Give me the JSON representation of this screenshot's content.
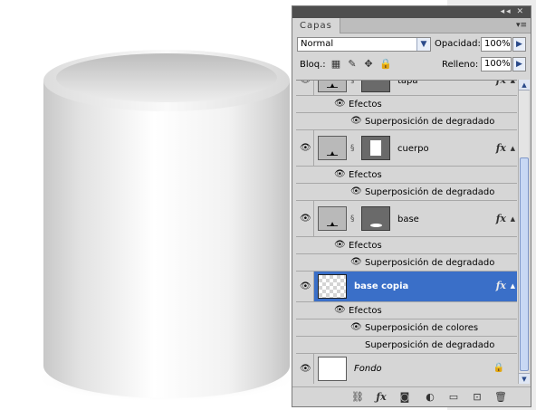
{
  "panel": {
    "tab_label": "Capas",
    "menu_icon": "panel-menu-icon",
    "collapse_icons": "◂◂ ✕",
    "blend_mode": "Normal",
    "opacity_label": "Opacidad:",
    "opacity_value": "100%",
    "lock_label": "Bloq.:",
    "fill_label": "Relleno:",
    "fill_value": "100%"
  },
  "layers": [
    {
      "name": "tapa",
      "effects_label": "Efectos",
      "effect": "Superposición de degradado",
      "fx": "fx"
    },
    {
      "name": "cuerpo",
      "effects_label": "Efectos",
      "effect": "Superposición de degradado",
      "fx": "fx"
    },
    {
      "name": "base",
      "effects_label": "Efectos",
      "effect": "Superposición de degradado",
      "fx": "fx"
    },
    {
      "name": "base copia",
      "effects_label": "Efectos",
      "effect1": "Superposición de colores",
      "effect2": "Superposición de degradado",
      "fx": "fx",
      "selected": true
    },
    {
      "name": "Fondo",
      "locked": true
    }
  ],
  "colors": {
    "selection": "#3a6fc8",
    "panel_bg": "#d6d6d6",
    "titlebar": "#4e4e4e"
  }
}
